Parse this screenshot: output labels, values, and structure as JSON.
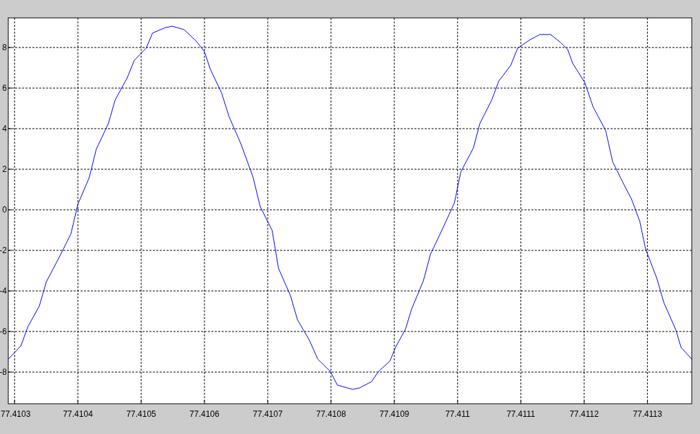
{
  "figure": {
    "chart_data": {
      "type": "line",
      "xlim": [
        77.41029,
        77.41137
      ],
      "ylim": [
        -9.56,
        9.46
      ],
      "grid": true,
      "xticks": [
        77.4103,
        77.4104,
        77.4105,
        77.4106,
        77.4107,
        77.4108,
        77.4109,
        {
          "value": 77.411,
          "label": "77.411"
        },
        77.4111,
        77.4112,
        77.4113
      ],
      "yticks": [
        {
          "value": -8,
          "label": "-8"
        },
        {
          "value": -6,
          "label": "-6"
        },
        {
          "value": -4,
          "label": "-4"
        },
        {
          "value": -2,
          "label": "-2"
        },
        {
          "value": 0,
          "label": "0"
        },
        {
          "value": 2,
          "label": "2"
        },
        {
          "value": 4,
          "label": "4"
        },
        {
          "value": 6,
          "label": "6"
        },
        {
          "value": 8,
          "label": "8"
        }
      ],
      "x": [
        77.41029,
        77.41031,
        77.410321,
        77.410339,
        77.41035,
        77.41037,
        77.410389,
        77.4104,
        77.410418,
        77.410429,
        77.410448,
        77.410459,
        77.410478,
        77.410489,
        77.410508,
        77.410518,
        77.410538,
        77.410549,
        77.410568,
        77.410587,
        77.4106,
        77.410609,
        77.410627,
        77.410639,
        77.410658,
        77.410677,
        77.410688,
        77.410707,
        77.410717,
        77.410736,
        77.410747,
        77.410766,
        77.410779,
        77.410799,
        77.41081,
        77.410834,
        77.410845,
        77.410864,
        77.410875,
        77.410893,
        77.410902,
        77.410918,
        77.410927,
        77.410946,
        77.410957,
        77.410975,
        77.410995,
        77.411005,
        77.411025,
        77.411035,
        77.411054,
        77.411065,
        77.411084,
        77.411095,
        77.411114,
        77.41113,
        77.411147,
        77.411163,
        77.411174,
        77.411182,
        77.411201,
        77.411214,
        77.411234,
        77.411245,
        77.411261,
        77.411275,
        77.411288,
        77.411297,
        77.411315,
        77.411326,
        77.411345,
        77.411353,
        77.41137
      ],
      "series": [
        {
          "color": "#0000ff",
          "values": [
            -7.36,
            -6.71,
            -5.76,
            -4.75,
            -3.56,
            -2.37,
            -1.19,
            0.27,
            1.59,
            2.98,
            4.24,
            5.42,
            6.51,
            7.36,
            7.97,
            8.71,
            8.98,
            9.05,
            8.88,
            8.31,
            7.8,
            6.95,
            5.76,
            4.58,
            3.22,
            1.59,
            0.17,
            -1.02,
            -2.88,
            -4.24,
            -5.42,
            -6.44,
            -7.36,
            -7.97,
            -8.64,
            -8.85,
            -8.78,
            -8.47,
            -7.97,
            -7.46,
            -6.78,
            -5.86,
            -4.92,
            -3.49,
            -2.2,
            -1.02,
            0.34,
            1.86,
            3.05,
            4.24,
            5.42,
            6.34,
            7.12,
            7.97,
            8.37,
            8.64,
            8.64,
            8.24,
            7.9,
            7.22,
            6.27,
            5.08,
            3.9,
            2.37,
            1.36,
            0.51,
            -0.58,
            -1.93,
            -3.39,
            -4.58,
            -5.93,
            -6.78,
            -7.36
          ]
        }
      ]
    }
  }
}
